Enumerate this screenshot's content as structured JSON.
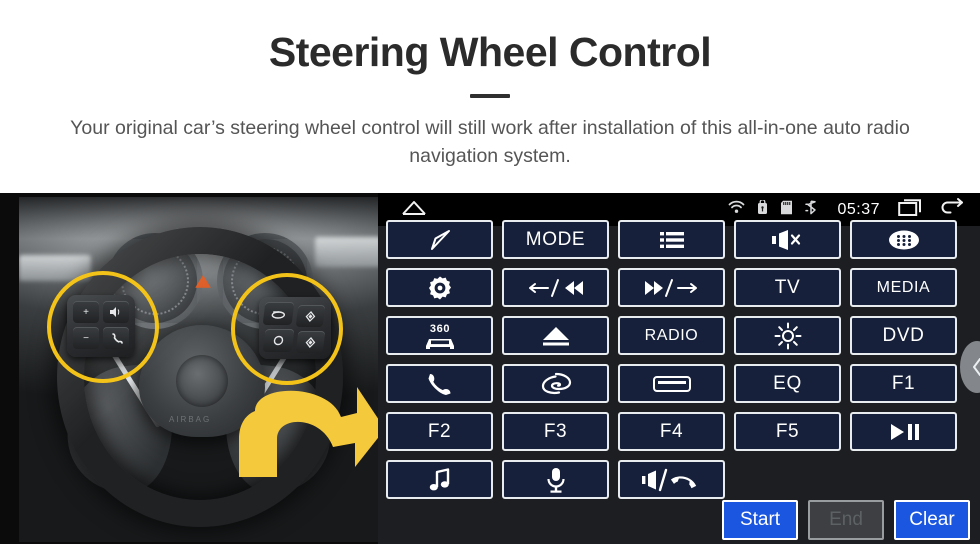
{
  "header": {
    "title": "Steering Wheel Control",
    "subtitle": "Your original car’s steering wheel control will still work after installation of this all-in-one auto radio navigation system."
  },
  "photo": {
    "alt_label": "car-steering-wheel-with-control-buttons",
    "highlight_color": "#f3c319",
    "arrow_color": "#f5c93c",
    "airbag_text": "AIRBAG",
    "left_pad_keys": [
      "+",
      "−",
      "mode-voice-icon",
      "phone-icon"
    ],
    "right_pad_keys": [
      "cruise-icon",
      "up-icon",
      "cancel-icon",
      "down-icon"
    ]
  },
  "unit": {
    "accent_color": "#1a56e0",
    "button_fill": "#16203a",
    "statusbar": {
      "home_icon": "home-icon",
      "wifi_icon": "wifi-icon",
      "usb_icon": "usb-icon",
      "sdcard_icon": "sd-card-icon",
      "bluetooth_icon": "bluetooth-icon",
      "clock": "05:37",
      "recents_icon": "recent-apps-icon",
      "back_icon": "back-arrow-icon"
    },
    "side_handle_icon": "chevron-left-icon",
    "rows": [
      [
        {
          "name": "navigation",
          "type": "icon",
          "icon": "navigation-arrow-icon",
          "label": ""
        },
        {
          "name": "mode",
          "type": "text",
          "icon": "",
          "label": "MODE"
        },
        {
          "name": "list",
          "type": "icon",
          "icon": "list-icon",
          "label": ""
        },
        {
          "name": "mute",
          "type": "icon",
          "icon": "mute-icon",
          "label": ""
        },
        {
          "name": "apps",
          "type": "icon",
          "icon": "app-grid-icon",
          "label": ""
        }
      ],
      [
        {
          "name": "settings",
          "type": "icon",
          "icon": "gear-icon",
          "label": ""
        },
        {
          "name": "previous",
          "type": "icon",
          "icon": "prev-track-icon",
          "label": ""
        },
        {
          "name": "next",
          "type": "icon",
          "icon": "next-track-icon",
          "label": ""
        },
        {
          "name": "tv",
          "type": "text",
          "icon": "",
          "label": "TV"
        },
        {
          "name": "media",
          "type": "text",
          "icon": "",
          "label": "MEDIA"
        }
      ],
      [
        {
          "name": "camera-360",
          "type": "icon",
          "icon": "car-360-icon",
          "label": "360"
        },
        {
          "name": "eject",
          "type": "icon",
          "icon": "eject-icon",
          "label": ""
        },
        {
          "name": "radio",
          "type": "text",
          "icon": "",
          "label": "RADIO"
        },
        {
          "name": "brightness",
          "type": "icon",
          "icon": "brightness-icon",
          "label": ""
        },
        {
          "name": "dvd",
          "type": "text",
          "icon": "",
          "label": "DVD"
        }
      ],
      [
        {
          "name": "phone",
          "type": "icon",
          "icon": "phone-icon",
          "label": ""
        },
        {
          "name": "browser",
          "type": "icon",
          "icon": "browser-icon",
          "label": ""
        },
        {
          "name": "screen",
          "type": "icon",
          "icon": "screen-icon",
          "label": ""
        },
        {
          "name": "eq",
          "type": "text",
          "icon": "",
          "label": "EQ"
        },
        {
          "name": "f1",
          "type": "text",
          "icon": "",
          "label": "F1"
        }
      ],
      [
        {
          "name": "f2",
          "type": "text",
          "icon": "",
          "label": "F2"
        },
        {
          "name": "f3",
          "type": "text",
          "icon": "",
          "label": "F3"
        },
        {
          "name": "f4",
          "type": "text",
          "icon": "",
          "label": "F4"
        },
        {
          "name": "f5",
          "type": "text",
          "icon": "",
          "label": "F5"
        },
        {
          "name": "play-pause",
          "type": "icon",
          "icon": "play-pause-icon",
          "label": ""
        }
      ],
      [
        {
          "name": "music",
          "type": "icon",
          "icon": "music-note-icon",
          "label": ""
        },
        {
          "name": "voice",
          "type": "icon",
          "icon": "microphone-icon",
          "label": ""
        },
        {
          "name": "volume-hangup",
          "type": "icon",
          "icon": "volume-hangup-icon",
          "label": ""
        }
      ]
    ],
    "footer": {
      "start": "Start",
      "end": "End",
      "clear": "Clear",
      "end_disabled": true
    }
  }
}
